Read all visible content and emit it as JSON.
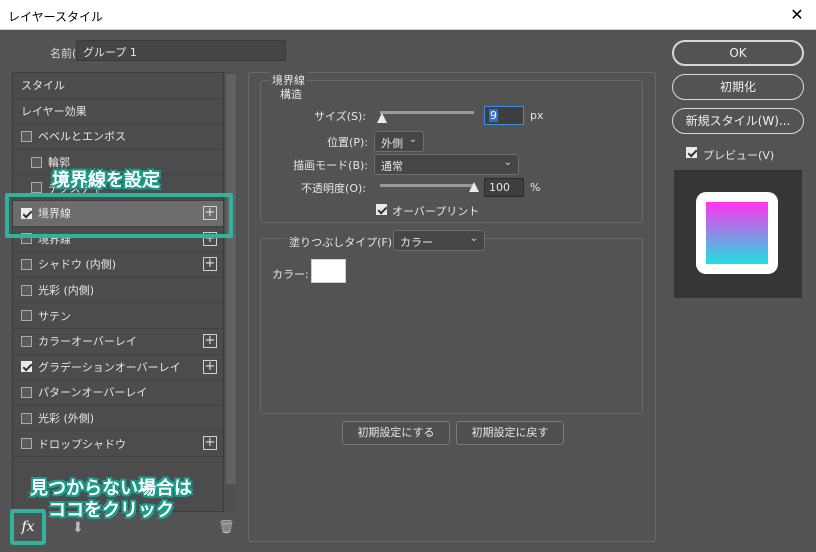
{
  "window": {
    "title": "レイヤースタイル"
  },
  "name_field": {
    "label": "名前(N):",
    "value": "グループ 1"
  },
  "styles_list": [
    {
      "label": "スタイル",
      "checkbox": false,
      "checked": false,
      "plus": false,
      "sub": false,
      "active": false
    },
    {
      "label": "レイヤー効果",
      "checkbox": false,
      "checked": false,
      "plus": false,
      "sub": false,
      "active": false
    },
    {
      "label": "ベベルとエンボス",
      "checkbox": true,
      "checked": false,
      "plus": false,
      "sub": false,
      "active": false
    },
    {
      "label": "輪郭",
      "checkbox": true,
      "checked": false,
      "plus": false,
      "sub": true,
      "active": false
    },
    {
      "label": "テクスチャ",
      "checkbox": true,
      "checked": false,
      "plus": false,
      "sub": true,
      "active": false
    },
    {
      "label": "境界線",
      "checkbox": true,
      "checked": true,
      "plus": true,
      "sub": false,
      "active": true
    },
    {
      "label": "境界線",
      "checkbox": true,
      "checked": false,
      "plus": true,
      "sub": false,
      "active": false
    },
    {
      "label": "シャドウ (内側)",
      "checkbox": true,
      "checked": false,
      "plus": true,
      "sub": false,
      "active": false
    },
    {
      "label": "光彩 (内側)",
      "checkbox": true,
      "checked": false,
      "plus": false,
      "sub": false,
      "active": false
    },
    {
      "label": "サテン",
      "checkbox": true,
      "checked": false,
      "plus": false,
      "sub": false,
      "active": false
    },
    {
      "label": "カラーオーバーレイ",
      "checkbox": true,
      "checked": false,
      "plus": true,
      "sub": false,
      "active": false
    },
    {
      "label": "グラデーションオーバーレイ",
      "checkbox": true,
      "checked": true,
      "plus": true,
      "sub": false,
      "active": false
    },
    {
      "label": "パターンオーバーレイ",
      "checkbox": true,
      "checked": false,
      "plus": false,
      "sub": false,
      "active": false
    },
    {
      "label": "光彩 (外側)",
      "checkbox": true,
      "checked": false,
      "plus": false,
      "sub": false,
      "active": false
    },
    {
      "label": "ドロップシャドウ",
      "checkbox": true,
      "checked": false,
      "plus": true,
      "sub": false,
      "active": false
    }
  ],
  "annotations": {
    "set_stroke": "境界線を設定",
    "not_found_line1": "見つからない場合は",
    "not_found_line2": "ココをクリック"
  },
  "bottom_tools": {
    "fx": "fx",
    "arrow": "⬇",
    "trash": "🗑"
  },
  "stroke": {
    "title": "境界線",
    "subtitle": "構造",
    "size": {
      "label": "サイズ(S):",
      "value": "9",
      "unit": "px",
      "fraction": 0.02
    },
    "position": {
      "label": "位置(P):",
      "value": "外側"
    },
    "blend_mode": {
      "label": "描画モード(B):",
      "value": "通常"
    },
    "opacity": {
      "label": "不透明度(O):",
      "value": "100",
      "unit": "%",
      "fraction": 1.0
    },
    "overprint": {
      "label": "オーバープリント",
      "checked": true
    }
  },
  "fill": {
    "type_label": "塗りつぶしタイプ(F):",
    "type_value": "カラー",
    "color_label": "カラー:",
    "color_value": "#ffffff"
  },
  "buttons": {
    "make_default": "初期設定にする",
    "reset_default": "初期設定に戻す",
    "ok": "OK",
    "reset": "初期化",
    "new_style": "新規スタイル(W)..."
  },
  "preview": {
    "label": "プレビュー(V)",
    "checked": true
  },
  "colors": {
    "accent": "#2fb3a0",
    "gradient_top": "#ff33ee",
    "gradient_bottom": "#20e0e0"
  }
}
